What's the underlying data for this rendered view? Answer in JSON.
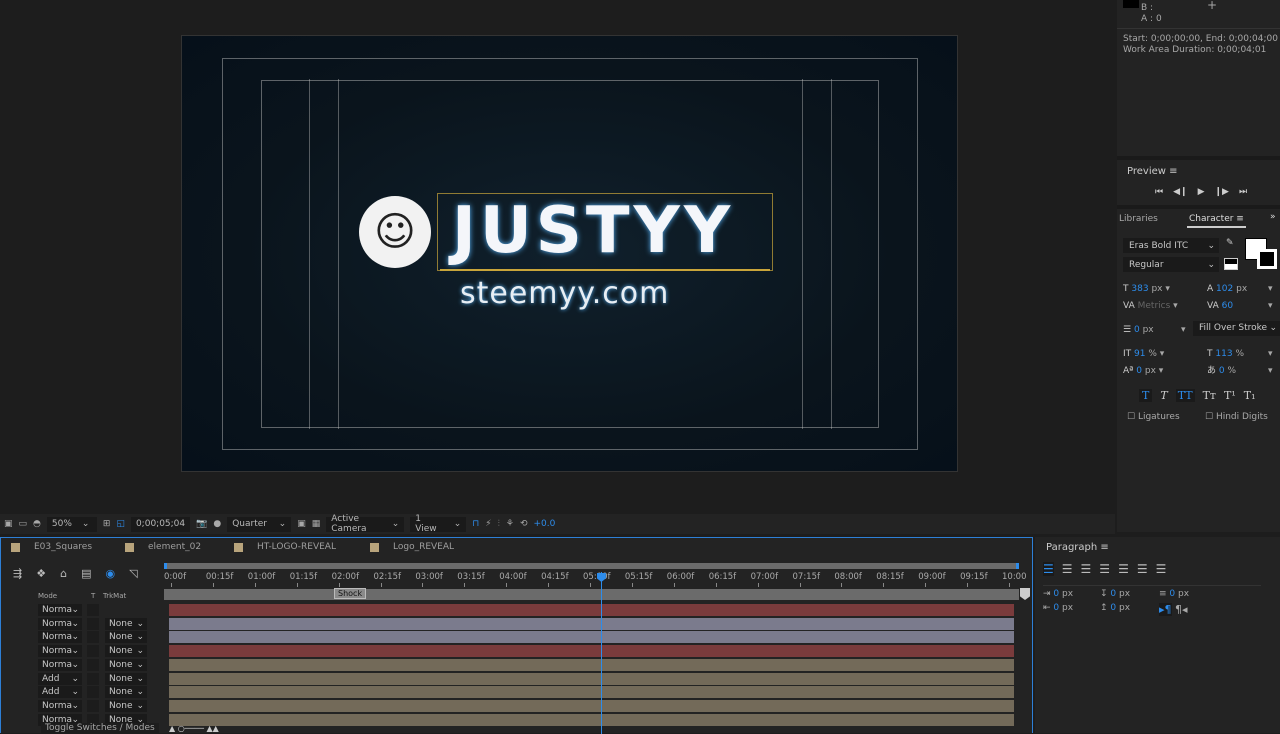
{
  "info": {
    "b_label": "B :",
    "a_label": "A :",
    "a_value": "0",
    "start_end": "Start: 0;00;00;00, End: 0;00;04;00",
    "work_area": "Work Area Duration: 0;00;04;01"
  },
  "preview": {
    "title": "Preview",
    "menu": "≡",
    "controls": [
      "⏮",
      "◀❙",
      "▶",
      "❙▶",
      "⏭"
    ]
  },
  "character": {
    "tabs": [
      "Libraries",
      "Character"
    ],
    "font": "Eras Bold ITC",
    "style": "Regular",
    "size": "383",
    "size_unit": "px",
    "leading": "102",
    "leading_unit": "px",
    "kerning": "Metrics",
    "tracking": "60",
    "stroke": "0",
    "stroke_unit": "px",
    "stroke_mode": "Fill Over Stroke",
    "vscale": "91",
    "vscale_unit": "%",
    "hscale": "113",
    "hscale_unit": "%",
    "baseline": "0",
    "baseline_unit": "px",
    "tsume": "0",
    "tsume_unit": "%",
    "styles": [
      "T",
      "T",
      "TT",
      "Tт",
      "T¹",
      "T₁"
    ],
    "ligatures": "Ligatures",
    "hindi_digits": "Hindi Digits"
  },
  "comp": {
    "title": "JUSTYY",
    "subtitle": "steemyy.com"
  },
  "viewer_toolbar": {
    "zoom": "50%",
    "timecode": "0;00;05;04",
    "resolution": "Quarter",
    "camera": "Active Camera",
    "views": "1 View",
    "exposure": "+0.0"
  },
  "timeline": {
    "tabs": [
      "E03_Squares",
      "element_02",
      "HT-LOGO-REVEAL",
      "Logo_REVEAL"
    ],
    "col_mode": "Mode",
    "col_t": "T",
    "col_trkmat": "TrkMat",
    "ruler": [
      "0:00f",
      "00:15f",
      "01:00f",
      "01:15f",
      "02:00f",
      "02:15f",
      "03:00f",
      "03:15f",
      "04:00f",
      "04:15f",
      "05:00f",
      "05:15f",
      "06:00f",
      "06:15f",
      "07:00f",
      "07:15f",
      "08:00f",
      "08:15f",
      "09:00f",
      "09:15f",
      "10:00"
    ],
    "marker": "Shock",
    "playhead_seconds": 5.13,
    "duration_seconds": 10,
    "layers": [
      {
        "mode": "Norma",
        "trkmat": "",
        "color": "#7a3b3c"
      },
      {
        "mode": "Norma",
        "trkmat": "None",
        "color": "#7b7b8d"
      },
      {
        "mode": "Norma",
        "trkmat": "None",
        "color": "#7b7b8d"
      },
      {
        "mode": "Norma",
        "trkmat": "None",
        "color": "#7a3b3c"
      },
      {
        "mode": "Norma",
        "trkmat": "None",
        "color": "#736a59"
      },
      {
        "mode": "Add",
        "trkmat": "None",
        "color": "#736a59"
      },
      {
        "mode": "Add",
        "trkmat": "None",
        "color": "#736a59"
      },
      {
        "mode": "Norma",
        "trkmat": "None",
        "color": "#736a59"
      },
      {
        "mode": "Norma",
        "trkmat": "None",
        "color": "#736a59"
      }
    ],
    "toggle": "Toggle Switches / Modes"
  },
  "paragraph": {
    "title": "Paragraph",
    "menu": "≡",
    "indent_left": "0",
    "indent_right": "0",
    "indent_first": "0",
    "space_before": "0",
    "space_after": "0",
    "unit": "px"
  }
}
